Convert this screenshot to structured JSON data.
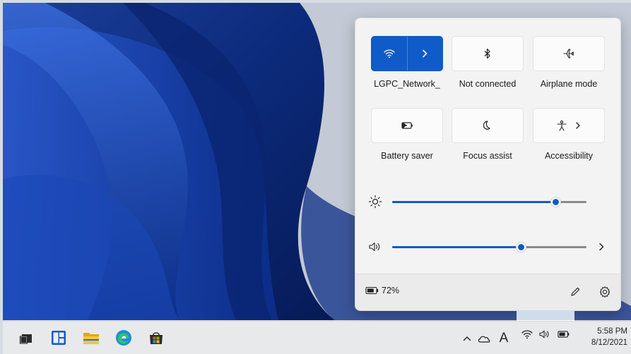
{
  "quick_settings": {
    "tiles": [
      {
        "id": "wifi",
        "label": "LGPC_Network_",
        "active": true,
        "icon": "wifi-icon"
      },
      {
        "id": "bluetooth",
        "label": "Not connected",
        "active": false,
        "icon": "bluetooth-icon"
      },
      {
        "id": "airplane",
        "label": "Airplane mode",
        "active": false,
        "icon": "airplane-icon"
      },
      {
        "id": "battery-saver",
        "label": "Battery saver",
        "active": false,
        "icon": "battery-saver-icon"
      },
      {
        "id": "focus-assist",
        "label": "Focus assist",
        "active": false,
        "icon": "moon-icon"
      },
      {
        "id": "accessibility",
        "label": "Accessibility",
        "active": false,
        "icon": "accessibility-icon"
      }
    ],
    "brightness": {
      "icon": "sun-icon",
      "level": 0.84
    },
    "volume": {
      "icon": "speaker-icon",
      "level": 0.66
    },
    "footer": {
      "battery_percent": "72%",
      "battery_icon": "battery-icon",
      "edit_icon": "pencil-icon",
      "settings_icon": "gear-icon"
    },
    "accent_color": "#0f5bc7"
  },
  "taskbar": {
    "apps": [
      "task-view-icon",
      "widgets-icon",
      "file-explorer-icon",
      "edge-icon",
      "store-icon"
    ],
    "tray": {
      "ime_label": "A",
      "time": "5:58 PM",
      "date": "8/12/2021"
    }
  }
}
